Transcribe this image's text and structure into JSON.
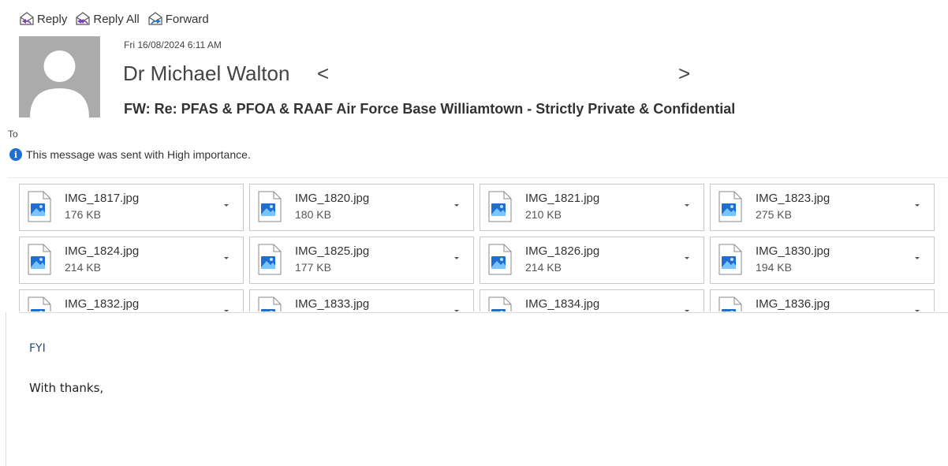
{
  "toolbar": {
    "reply_label": "Reply",
    "reply_all_label": "Reply All",
    "forward_label": "Forward"
  },
  "header": {
    "date": "Fri 16/08/2024 6:11 AM",
    "sender_name": "Dr Michael Walton",
    "email_open": "<",
    "email_close": ">",
    "subject": "FW: Re: PFAS & PFOA & RAAF Air Force Base Williamtown - Strictly Private & Confidential",
    "to_label": "To",
    "importance_notice": "This message was sent with High importance."
  },
  "attachments": [
    {
      "name": "IMG_1817.jpg",
      "size": "176 KB"
    },
    {
      "name": "IMG_1820.jpg",
      "size": "180 KB"
    },
    {
      "name": "IMG_1821.jpg",
      "size": "210 KB"
    },
    {
      "name": "IMG_1823.jpg",
      "size": "275 KB"
    },
    {
      "name": "IMG_1824.jpg",
      "size": "214 KB"
    },
    {
      "name": "IMG_1825.jpg",
      "size": "177 KB"
    },
    {
      "name": "IMG_1826.jpg",
      "size": "214 KB"
    },
    {
      "name": "IMG_1830.jpg",
      "size": "194 KB"
    },
    {
      "name": "IMG_1832.jpg",
      "size": ""
    },
    {
      "name": "IMG_1833.jpg",
      "size": ""
    },
    {
      "name": "IMG_1834.jpg",
      "size": ""
    },
    {
      "name": "IMG_1836.jpg",
      "size": ""
    }
  ],
  "body": {
    "fyi": "FYI",
    "closing": "With thanks,"
  },
  "colors": {
    "accent": "#1e6fcf",
    "body_link_text": "#1f4e79",
    "avatar_bg": "#ababab"
  },
  "icons": {
    "reply": "reply-envelope-icon",
    "reply_all": "reply-all-envelope-icon",
    "forward": "forward-envelope-icon",
    "info": "info-icon",
    "attachment": "image-file-icon",
    "dropdown": "chevron-down-icon"
  }
}
